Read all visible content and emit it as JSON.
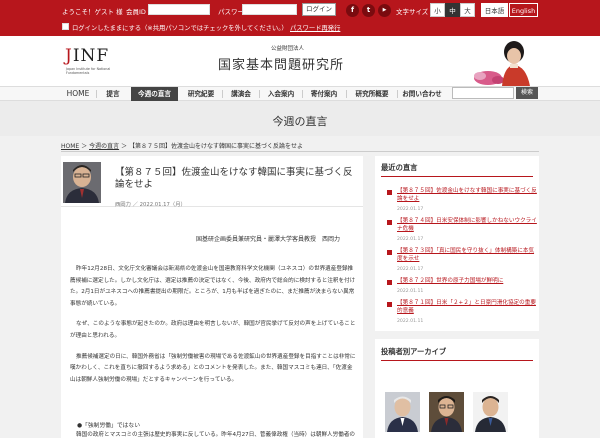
{
  "topbar": {
    "welcome": "ようこそ！ゲスト 様",
    "member_id_label": "会員ID",
    "password_label": "パスワード",
    "login_label": "ログイン",
    "keep_login_label": "ログインしたままにする（※共用パソコンではチェックを外してください。）",
    "forgot_password": "パスワード再発行",
    "font_size_label": "文字サイズ",
    "font_sizes": [
      "小",
      "中",
      "大"
    ],
    "lang_ja": "日本語",
    "lang_en": "English",
    "brand_color": "#b7161c"
  },
  "social": {
    "facebook_glyph": "f",
    "twitter_glyph": "t",
    "youtube_glyph": "▶"
  },
  "header": {
    "logo_letter_j": "J",
    "logo_rest": "INF",
    "logo_sub": "Japan Institute for National Fundamentals",
    "org_small": "公益財団法人",
    "org_name": "国家基本問題研究所"
  },
  "nav": {
    "items": [
      "HOME",
      "提言",
      "今週の直言",
      "研究紀要",
      "講演会",
      "入会案内",
      "寄付案内",
      "研究所概要",
      "お問い合わせ"
    ],
    "search_button": "検索"
  },
  "page": {
    "title": "今週の直言"
  },
  "breadcrumb": {
    "home": "HOME",
    "sep1": "＞",
    "section": "今週の直言",
    "sep2": "＞",
    "current": "【第８７５回】佐渡金山をけなす韓国に事実に基づく反論をせよ"
  },
  "article": {
    "title": "【第８７５回】佐渡金山をけなす韓国に事実に基づく反論をせよ",
    "author": "西岡力",
    "date_sep": "／",
    "date": "2022.01.17（月）",
    "byline": "国基研企画委員兼研究員・麗澤大学客員教授　西岡力",
    "paragraphs": [
      "昨年12月28日、文化庁文化審議会は新潟県の佐渡金山を国連教育科学文化機関（ユネスコ）の世界遺産登録推薦候補に選定した。しかし文化庁は、選定は推薦の決定ではなく、今後、政府内で総合的に検討すると注釈を付けた。2月1日がユネスコへの推薦書提出の期限だ。ところが、1月も半ばを過ぎたのに、まだ推薦が決まらない異常事態が続いている。",
      "なぜ、このような事態が起きたのか。政府は理由を明言しないが、韓国が官民挙げて反対の声を上げていることが理由と思われる。",
      "推薦候補選定の日に、韓国外務省は「強制労働被害の現場である佐渡鉱山の世界遺産登録を目指すことは非常に嘆かわしく、これを直ちに撤回するよう求める」とのコメントを発表した。また、韓国マスコミも連日、「佐渡金山は朝鮮人強制労働の現場」だとするキャンペーンを行っている。"
    ],
    "bullet": "●「強制労働」ではない",
    "last_paragraph": "韓国の政府とマスコミの主張は歴史的事実に反している。昨年4月27日、菅義偉政権（当時）は朝鮮人労働者の戦時動員は「強制労働」ではないという次の閣議決定を行っている。"
  },
  "sidebar": {
    "title": "最近の直言",
    "items": [
      {
        "title": "【第８７５回】佐渡金山をけなす韓国に事実に基づく反論をせよ",
        "date": "2022.01.17"
      },
      {
        "title": "【第８７４回】日米安保体制に影響しかねないウクライナ危機",
        "date": "2022.01.17"
      },
      {
        "title": "【第８７３回】「真に国民を守り抜く」体制構築に本気度を示せ",
        "date": "2022.01.17"
      },
      {
        "title": "【第８７２回】世界の原子力国場が鮮明に",
        "date": "2022.01.11"
      },
      {
        "title": "【第８７１回】日米「２+２」と日豪円滑化協定の重要的意義",
        "date": "2022.01.11"
      }
    ]
  },
  "archive": {
    "title": "投稿者別アーカイブ"
  }
}
